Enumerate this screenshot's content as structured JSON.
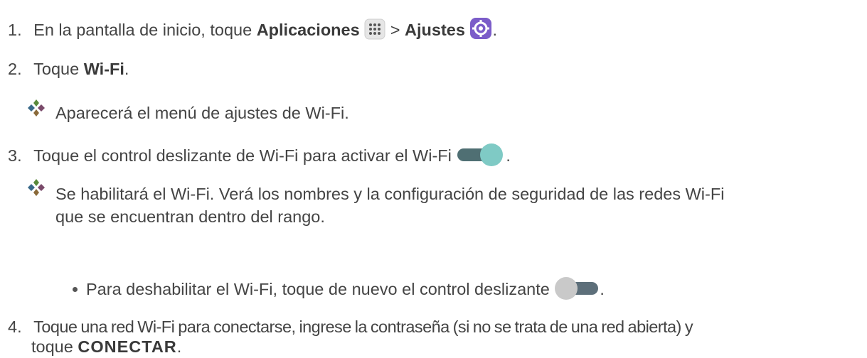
{
  "steps": [
    {
      "num": "1.",
      "pre": "En la pantalla de inicio, toque ",
      "b1": "Aplicaciones",
      "mid": " > ",
      "b2": "Ajustes",
      "post": "."
    },
    {
      "num": "2.",
      "pre": "Toque ",
      "b1": "Wi-Fi",
      "post": "."
    },
    {
      "num": "3.",
      "text": "Toque el control deslizante de Wi-Fi para activar el Wi-Fi",
      "post": "."
    },
    {
      "num": "4.",
      "line1": "Toque una red Wi-Fi para conectarse, ingrese la contraseña (si no se trata de una red abierta) y",
      "pre2": "toque ",
      "b1": "CONECTAR",
      "post": "."
    }
  ],
  "results": [
    {
      "text": "Aparecerá el menú de ajustes de Wi-Fi."
    },
    {
      "line1": "Se habilitará el Wi-Fi. Verá los nombres y la configuración de seguridad de las redes Wi-Fi",
      "line2": "que se encuentran dentro del rango."
    }
  ],
  "bullet": {
    "text": "Para deshabilitar el Wi-Fi, toque de nuevo el control deslizante",
    "post": "."
  },
  "icons": {
    "apps": "apps-grid-icon",
    "settings": "settings-gear-icon",
    "toggle_on": "toggle-on-icon",
    "toggle_off": "toggle-off-icon",
    "result": "diamond-bullet-icon",
    "toggle_on_track": "#4f6f73",
    "toggle_on_knob": "#7fcac5",
    "toggle_off_track": "#5d6f7a",
    "toggle_off_knob": "#c9c9c9",
    "settings_color": "#7b5cc9"
  }
}
